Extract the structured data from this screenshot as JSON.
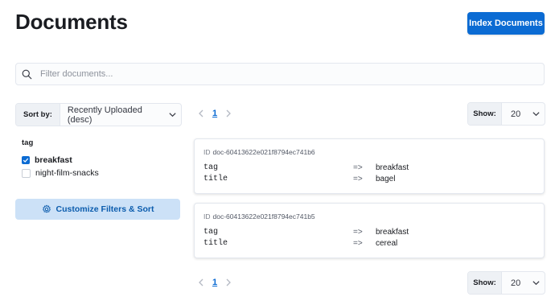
{
  "header": {
    "title": "Documents",
    "index_button": "Index Documents"
  },
  "search": {
    "placeholder": "Filter documents..."
  },
  "sort": {
    "label": "Sort by:",
    "value": "Recently Uploaded (desc)"
  },
  "facet": {
    "title": "tag",
    "options": [
      {
        "label": "breakfast",
        "checked": true
      },
      {
        "label": "night-film-snacks",
        "checked": false
      }
    ]
  },
  "customize_button": "Customize Filters & Sort",
  "pagination": {
    "current_page": "1"
  },
  "show": {
    "label": "Show:",
    "value": "20"
  },
  "results": [
    {
      "id_prefix": "ID",
      "id": "doc-60413622e021f8794ec741b6",
      "fields": [
        {
          "key": "tag",
          "arrow": "=>",
          "value": "breakfast"
        },
        {
          "key": "title",
          "arrow": "=>",
          "value": "bagel"
        }
      ]
    },
    {
      "id_prefix": "ID",
      "id": "doc-60413622e021f8794ec741b5",
      "fields": [
        {
          "key": "tag",
          "arrow": "=>",
          "value": "breakfast"
        },
        {
          "key": "title",
          "arrow": "=>",
          "value": "cereal"
        }
      ]
    }
  ],
  "icons": {
    "search": "search-icon",
    "chevron": "chevron-down-icon",
    "checkbox": "checkmark-icon",
    "gear": "gear-icon",
    "prev": "chevron-left-icon",
    "next": "chevron-right-icon"
  },
  "colors": {
    "accent": "#0b6bd3",
    "customize_bg": "#cce1f7",
    "customize_text": "#0b5cad"
  }
}
